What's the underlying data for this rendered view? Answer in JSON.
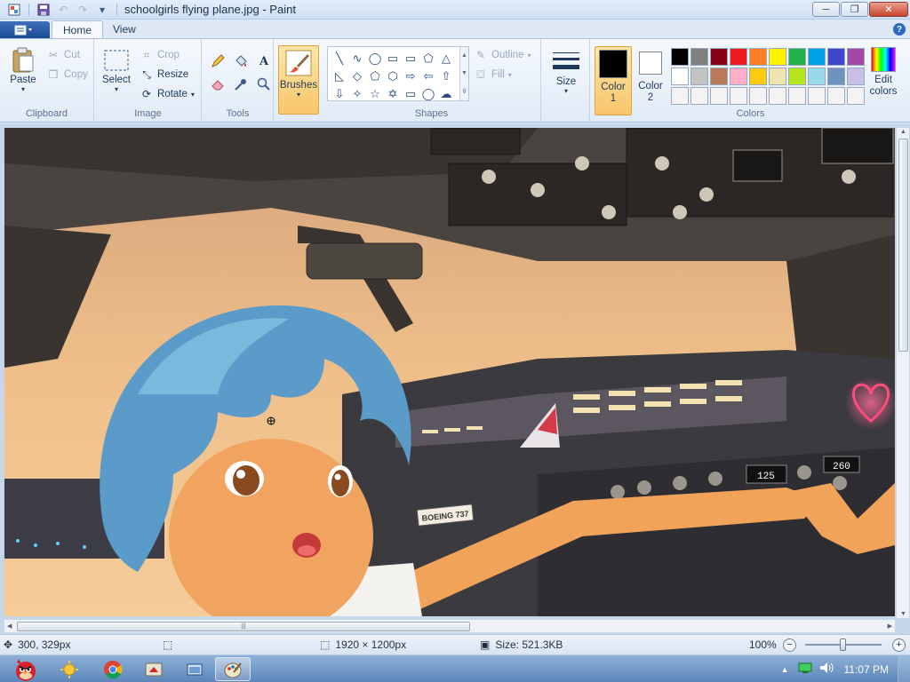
{
  "window": {
    "title": "schoolgirls flying plane.jpg - Paint",
    "minimize_glyph": "─",
    "maximize_glyph": "❐",
    "close_glyph": "✕"
  },
  "tabs": {
    "home": "Home",
    "view": "View",
    "help_glyph": "?"
  },
  "ribbon": {
    "clipboard": {
      "group_label": "Clipboard",
      "paste": "Paste",
      "cut": "Cut",
      "copy": "Copy"
    },
    "image": {
      "group_label": "Image",
      "select": "Select",
      "crop": "Crop",
      "resize": "Resize",
      "rotate": "Rotate"
    },
    "tools": {
      "group_label": "Tools",
      "text_glyph": "A"
    },
    "brushes": "Brushes",
    "shapes": {
      "group_label": "Shapes",
      "outline": "Outline",
      "fill": "Fill",
      "glyphs": [
        "╲",
        "∿",
        "◯",
        "▭",
        "▭",
        "⬠",
        "△",
        "◺",
        "◇",
        "⬠",
        "⬡",
        "⇨",
        "⇦",
        "⇧",
        "⇩",
        "✧",
        "☆",
        "✡",
        "▭",
        "◯",
        "☁"
      ]
    },
    "size": "Size",
    "colors": {
      "group_label": "Colors",
      "color1_line1": "Color",
      "color1_line2": "1",
      "color2_line1": "Color",
      "color2_line2": "2",
      "color1_value": "#000000",
      "color2_value": "#ffffff",
      "edit_line1": "Edit",
      "edit_line2": "colors",
      "palette": [
        "#000000",
        "#7f7f7f",
        "#880015",
        "#ed1c24",
        "#ff7f27",
        "#fff200",
        "#22b14c",
        "#00a2e8",
        "#3f48cc",
        "#a349a4",
        "#ffffff",
        "#c3c3c3",
        "#b97a57",
        "#ffaec9",
        "#ffc90e",
        "#efe4b0",
        "#b5e61d",
        "#99d9ea",
        "#7092be",
        "#c8bfe7",
        "#f3f3f3",
        "#f3f3f3",
        "#f3f3f3",
        "#f3f3f3",
        "#f3f3f3",
        "#f3f3f3",
        "#f3f3f3",
        "#f3f3f3",
        "#f3f3f3",
        "#f3f3f3"
      ]
    }
  },
  "canvas": {
    "cockpit_placard": "BOEING 737",
    "display_left": "125",
    "display_right": "260"
  },
  "status": {
    "cursor_position": "300, 329px",
    "image_dimensions": "1920 × 1200px",
    "file_size": "Size: 521.3KB",
    "zoom": "100%",
    "zoom_out_glyph": "−",
    "zoom_in_glyph": "+",
    "zoom_level": 0.5
  },
  "taskbar": {
    "clock": "11:07 PM",
    "tray_up_glyph": "▲"
  }
}
